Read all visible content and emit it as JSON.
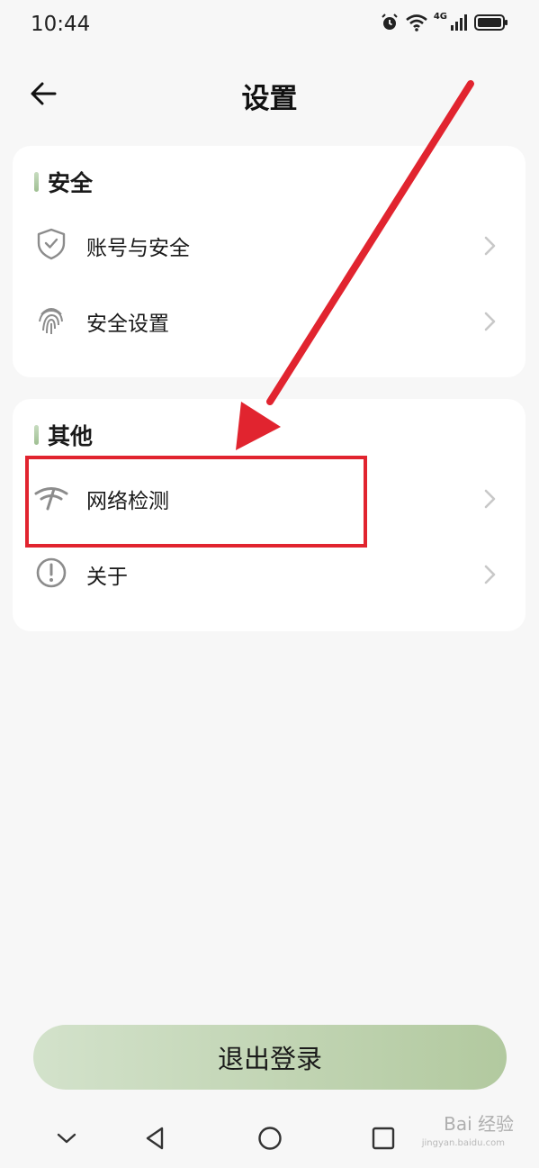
{
  "status_bar": {
    "time": "10:44",
    "network": "4G"
  },
  "header": {
    "title": "设置"
  },
  "sections": [
    {
      "title": "安全",
      "items": [
        {
          "label": "账号与安全",
          "icon": "shield-check-icon"
        },
        {
          "label": "安全设置",
          "icon": "fingerprint-icon"
        }
      ]
    },
    {
      "title": "其他",
      "items": [
        {
          "label": "网络检测",
          "icon": "network-check-icon"
        },
        {
          "label": "关于",
          "icon": "info-icon"
        }
      ]
    }
  ],
  "logout": {
    "label": "退出登录"
  },
  "watermark": {
    "text": "Bai 经验",
    "sub": "jingyan.baidu.com"
  },
  "colors": {
    "accent": "#b2c99f",
    "annotation": "#e1242f"
  }
}
